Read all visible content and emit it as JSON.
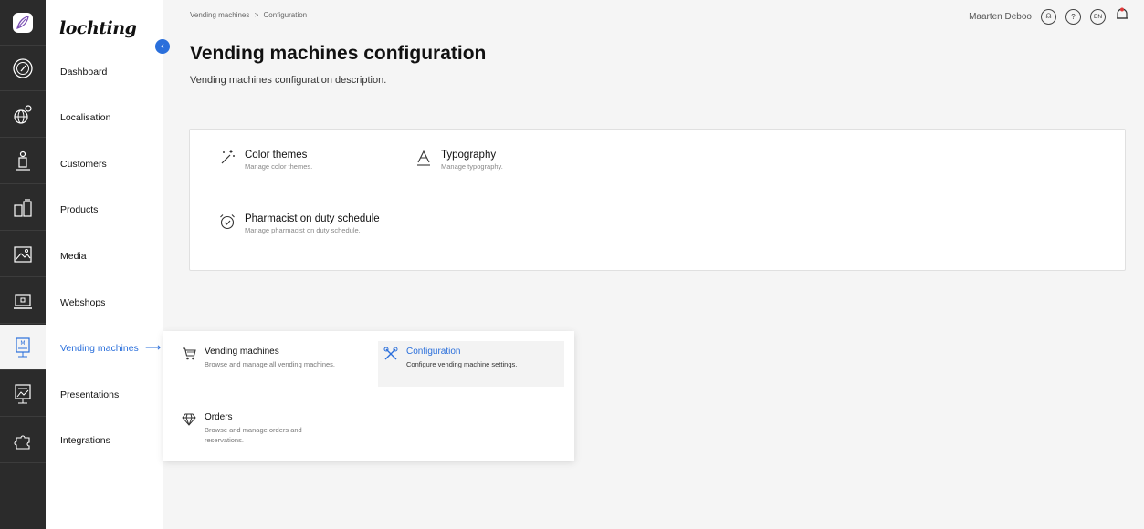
{
  "brand": {
    "logo_text": "lochting"
  },
  "breadcrumb": {
    "parent": "Vending machines",
    "separator": ">",
    "current": "Configuration"
  },
  "user": {
    "name": "Maarten Deboo",
    "language": "EN"
  },
  "page": {
    "title": "Vending machines configuration",
    "description": "Vending machines configuration description."
  },
  "nav": {
    "items": [
      {
        "label": "Dashboard",
        "icon": "gauge-icon"
      },
      {
        "label": "Localisation",
        "icon": "globe-pin-icon"
      },
      {
        "label": "Customers",
        "icon": "customer-icon"
      },
      {
        "label": "Products",
        "icon": "products-icon"
      },
      {
        "label": "Media",
        "icon": "image-icon"
      },
      {
        "label": "Webshops",
        "icon": "webshop-icon"
      },
      {
        "label": "Vending machines",
        "icon": "vending-machine-icon",
        "active": true
      },
      {
        "label": "Presentations",
        "icon": "presentation-icon"
      },
      {
        "label": "Integrations",
        "icon": "puzzle-icon"
      }
    ]
  },
  "config": {
    "tiles": [
      {
        "title": "Color themes",
        "description": "Manage color themes.",
        "icon": "magic-wand-icon"
      },
      {
        "title": "Typography",
        "description": "Manage typography.",
        "icon": "typography-icon"
      },
      {
        "title": "Pharmacist on duty schedule",
        "description": "Manage pharmacist on duty schedule.",
        "icon": "alarm-clock-icon"
      }
    ]
  },
  "dropdown": {
    "items": [
      {
        "title": "Vending machines",
        "description": "Browse and manage all vending machines.",
        "icon": "cart-icon"
      },
      {
        "title": "Configuration",
        "description": "Configure vending machine settings.",
        "icon": "tools-icon",
        "active": true
      },
      {
        "title": "Orders",
        "description": "Browse and manage orders and reservations.",
        "icon": "diamond-icon"
      }
    ]
  },
  "colors": {
    "accent": "#2a6fdb",
    "rail": "#2b2b2b",
    "background": "#f5f5f5"
  }
}
